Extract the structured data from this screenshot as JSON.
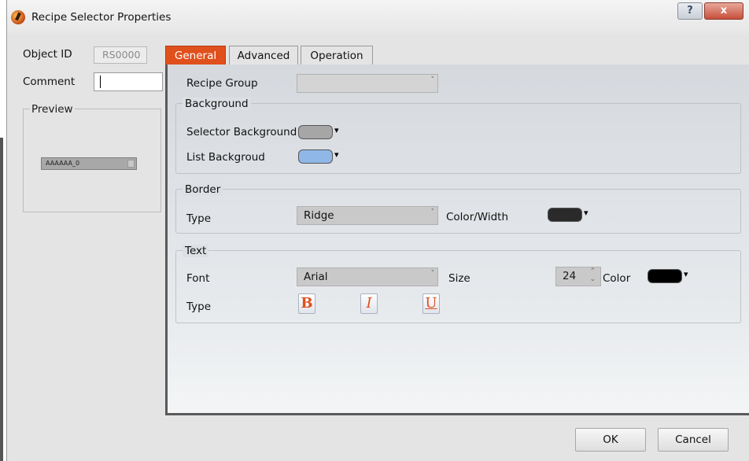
{
  "window": {
    "title": "Recipe Selector Properties"
  },
  "title_controls": {
    "help_label": "?",
    "close_label": "x"
  },
  "left": {
    "object_id_label": "Object ID",
    "object_id_value": "RS0000",
    "comment_label": "Comment",
    "comment_value": "",
    "preview_label": "Preview",
    "preview_combo_text": "AAAAAA_0"
  },
  "tabs": [
    {
      "label": "General",
      "active": true
    },
    {
      "label": "Advanced",
      "active": false
    },
    {
      "label": "Operation",
      "active": false
    }
  ],
  "general": {
    "recipe_group_label": "Recipe Group",
    "recipe_group_value": "",
    "background": {
      "title": "Background",
      "selector_bg_label": "Selector Background",
      "selector_bg_color": "#a6a6a6",
      "list_bg_label": "List Backgroud",
      "list_bg_color": "#8fb8e8"
    },
    "border": {
      "title": "Border",
      "type_label": "Type",
      "type_value": "Ridge",
      "color_width_label": "Color/Width",
      "color": "#2a2a2a"
    },
    "text": {
      "title": "Text",
      "font_label": "Font",
      "font_value": "Arial",
      "size_label": "Size",
      "size_value": "24",
      "color_label": "Color",
      "color": "#000000",
      "type_label": "Type",
      "bold_label": "B",
      "italic_label": "I",
      "underline_label": "U"
    }
  },
  "buttons": {
    "ok": "OK",
    "cancel": "Cancel"
  },
  "icons": {
    "app": "recipe-app-icon",
    "dropdown": "▾",
    "combo_arrow": "˅",
    "spin": "⌃⌄"
  }
}
